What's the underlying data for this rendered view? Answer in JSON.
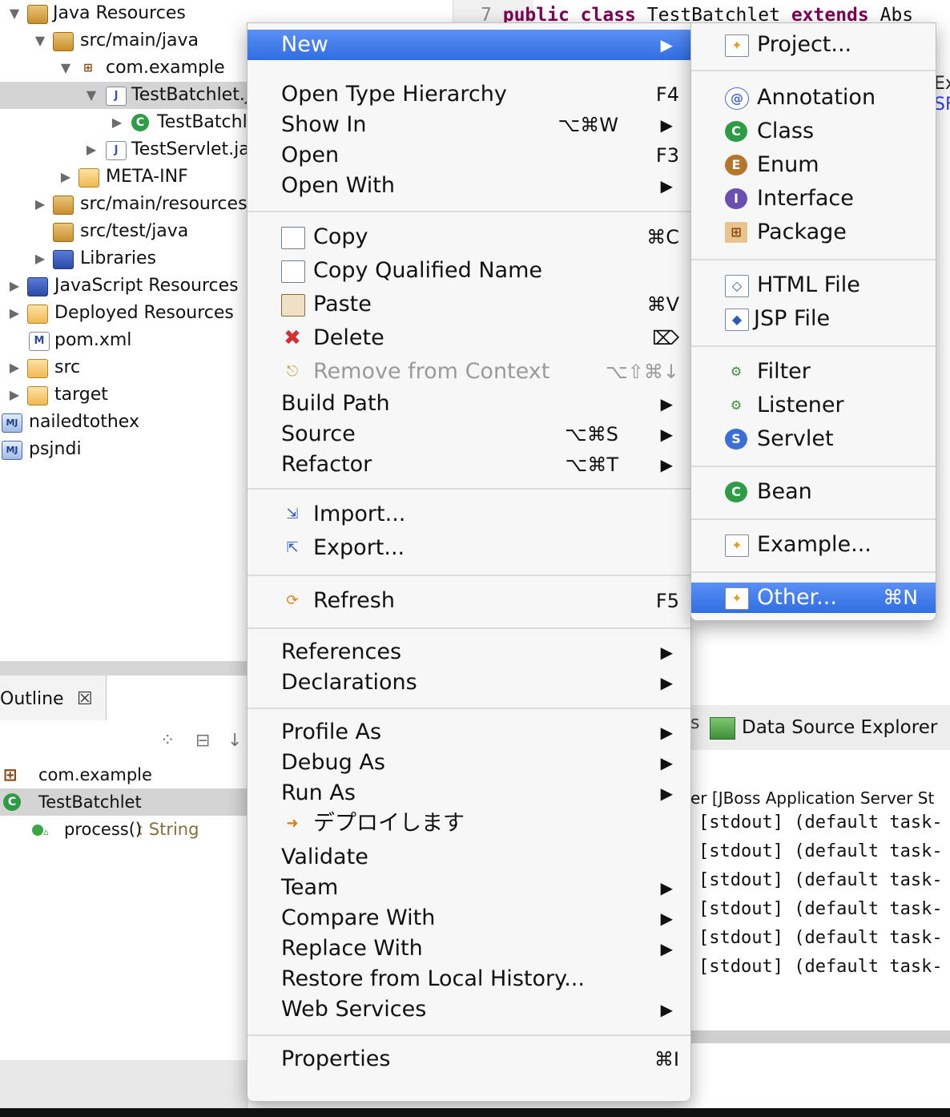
{
  "explorer": {
    "rows": [
      {
        "label": "Java Resources",
        "twisty": "▼",
        "icon": "java-resources-icon"
      },
      {
        "label": "src/main/java",
        "twisty": "▼",
        "icon": "source-folder-icon"
      },
      {
        "label": "com.example",
        "twisty": "▼",
        "icon": "package-icon"
      },
      {
        "label": "TestBatchlet.j",
        "twisty": "▼",
        "icon": "java-file-icon"
      },
      {
        "label": "TestBatchl",
        "twisty": "▶",
        "icon": "class-icon"
      },
      {
        "label": "TestServlet.ja",
        "twisty": "▶",
        "icon": "java-file-icon"
      },
      {
        "label": "META-INF",
        "twisty": "▶",
        "icon": "folder-icon"
      },
      {
        "label": "src/main/resources",
        "twisty": "▶",
        "icon": "source-folder-icon"
      },
      {
        "label": "src/test/java",
        "twisty": "",
        "icon": "source-folder-icon"
      },
      {
        "label": "Libraries",
        "twisty": "▶",
        "icon": "libraries-icon"
      },
      {
        "label": "JavaScript Resources",
        "twisty": "▶",
        "icon": "javascript-resources-icon"
      },
      {
        "label": "Deployed Resources",
        "twisty": "▶",
        "icon": "deployed-resources-icon"
      },
      {
        "label": "pom.xml",
        "twisty": "",
        "icon": "maven-pom-icon"
      },
      {
        "label": "src",
        "twisty": "▶",
        "icon": "folder-icon"
      },
      {
        "label": "target",
        "twisty": "▶",
        "icon": "folder-icon"
      },
      {
        "label": "nailedtothex",
        "twisty": "",
        "icon": "project-icon"
      },
      {
        "label": "psjndi",
        "twisty": "",
        "icon": "project-icon"
      }
    ]
  },
  "outline": {
    "tab_label": "Outline",
    "close_glyph": "☒",
    "rows": [
      {
        "label": "com.example"
      },
      {
        "label": "TestBatchlet"
      },
      {
        "label": "process()",
        "type": " : String"
      }
    ]
  },
  "editor": {
    "line_number": "7",
    "tokens": [
      "public",
      "class",
      "TestBatchlet",
      "extends",
      "Abs"
    ],
    "right_fragment_1": "Ex",
    "right_fragment_2": "SF"
  },
  "console": {
    "tab_tail": "s",
    "tab_label": "Data Source Explorer",
    "title": "er [JBoss Application Server St",
    "lines": [
      "[stdout] (default task-",
      "[stdout] (default task-",
      "[stdout] (default task-",
      "[stdout] (default task-",
      "[stdout] (default task-",
      "[stdout] (default task-"
    ]
  },
  "context_menu": {
    "new": {
      "label": "New",
      "arrow": "▶"
    },
    "items": [
      {
        "label": "Open Type Hierarchy",
        "shortcut": "F4"
      },
      {
        "label": "Show In",
        "shortcut": "⌥⌘W",
        "arrow": "▶"
      },
      {
        "label": "Open",
        "shortcut": "F3"
      },
      {
        "label": "Open With",
        "arrow": "▶"
      },
      {
        "label": "Copy",
        "shortcut": "⌘C"
      },
      {
        "label": "Copy Qualified Name"
      },
      {
        "label": "Paste",
        "shortcut": "⌘V"
      },
      {
        "label": "Delete",
        "shortcut": "⌦"
      },
      {
        "label": "Remove from Context",
        "shortcut": "⌥⇧⌘↓"
      },
      {
        "label": "Build Path",
        "arrow": "▶"
      },
      {
        "label": "Source",
        "shortcut": "⌥⌘S",
        "arrow": "▶"
      },
      {
        "label": "Refactor",
        "shortcut": "⌥⌘T",
        "arrow": "▶"
      },
      {
        "label": "Import..."
      },
      {
        "label": "Export..."
      },
      {
        "label": "Refresh",
        "shortcut": "F5"
      },
      {
        "label": "References",
        "arrow": "▶"
      },
      {
        "label": "Declarations",
        "arrow": "▶"
      },
      {
        "label": "Profile As",
        "arrow": "▶"
      },
      {
        "label": "Debug As",
        "arrow": "▶"
      },
      {
        "label": "Run As",
        "arrow": "▶"
      },
      {
        "label": "デプロイします"
      },
      {
        "label": "Validate"
      },
      {
        "label": "Team",
        "arrow": "▶"
      },
      {
        "label": "Compare With",
        "arrow": "▶"
      },
      {
        "label": "Replace With",
        "arrow": "▶"
      },
      {
        "label": "Restore from Local History..."
      },
      {
        "label": "Web Services",
        "arrow": "▶"
      },
      {
        "label": "Properties",
        "shortcut": "⌘I"
      }
    ]
  },
  "new_submenu": {
    "items": [
      {
        "label": "Project..."
      },
      {
        "label": "Annotation"
      },
      {
        "label": "Class"
      },
      {
        "label": "Enum"
      },
      {
        "label": "Interface"
      },
      {
        "label": "Package"
      },
      {
        "label": "HTML File"
      },
      {
        "label": "JSP File"
      },
      {
        "label": "Filter"
      },
      {
        "label": "Listener"
      },
      {
        "label": "Servlet"
      },
      {
        "label": "Bean"
      },
      {
        "label": "Example..."
      },
      {
        "label": "Other...",
        "shortcut": "⌘N"
      }
    ]
  },
  "colors": {
    "highlight": "#2f6ee3",
    "selection_gray": "#d4d4d4",
    "keyword": "#7f0055",
    "disabled_text": "#9a9a9a"
  }
}
